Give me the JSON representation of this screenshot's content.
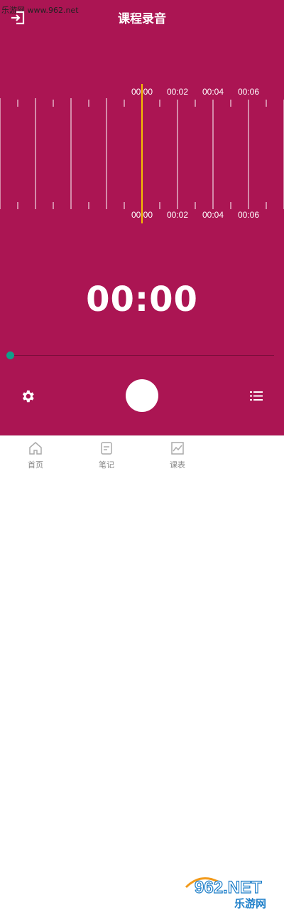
{
  "watermark": "乐游网 www.962.net",
  "header": {
    "title": "课程录音"
  },
  "waveform": {
    "time_labels": [
      "00:00",
      "00:02",
      "00:04",
      "00:06"
    ]
  },
  "recorder": {
    "elapsed": "00:00",
    "progress": 0
  },
  "tabs": [
    {
      "label": "首页",
      "icon": "home-icon"
    },
    {
      "label": "笔记",
      "icon": "note-icon"
    },
    {
      "label": "课表",
      "icon": "chart-icon"
    }
  ],
  "logo": {
    "text_top": "962.NET",
    "text_bottom": "乐游网"
  },
  "colors": {
    "background": "#ab1553",
    "playhead": "#f5c000",
    "knob": "#11a08a"
  }
}
